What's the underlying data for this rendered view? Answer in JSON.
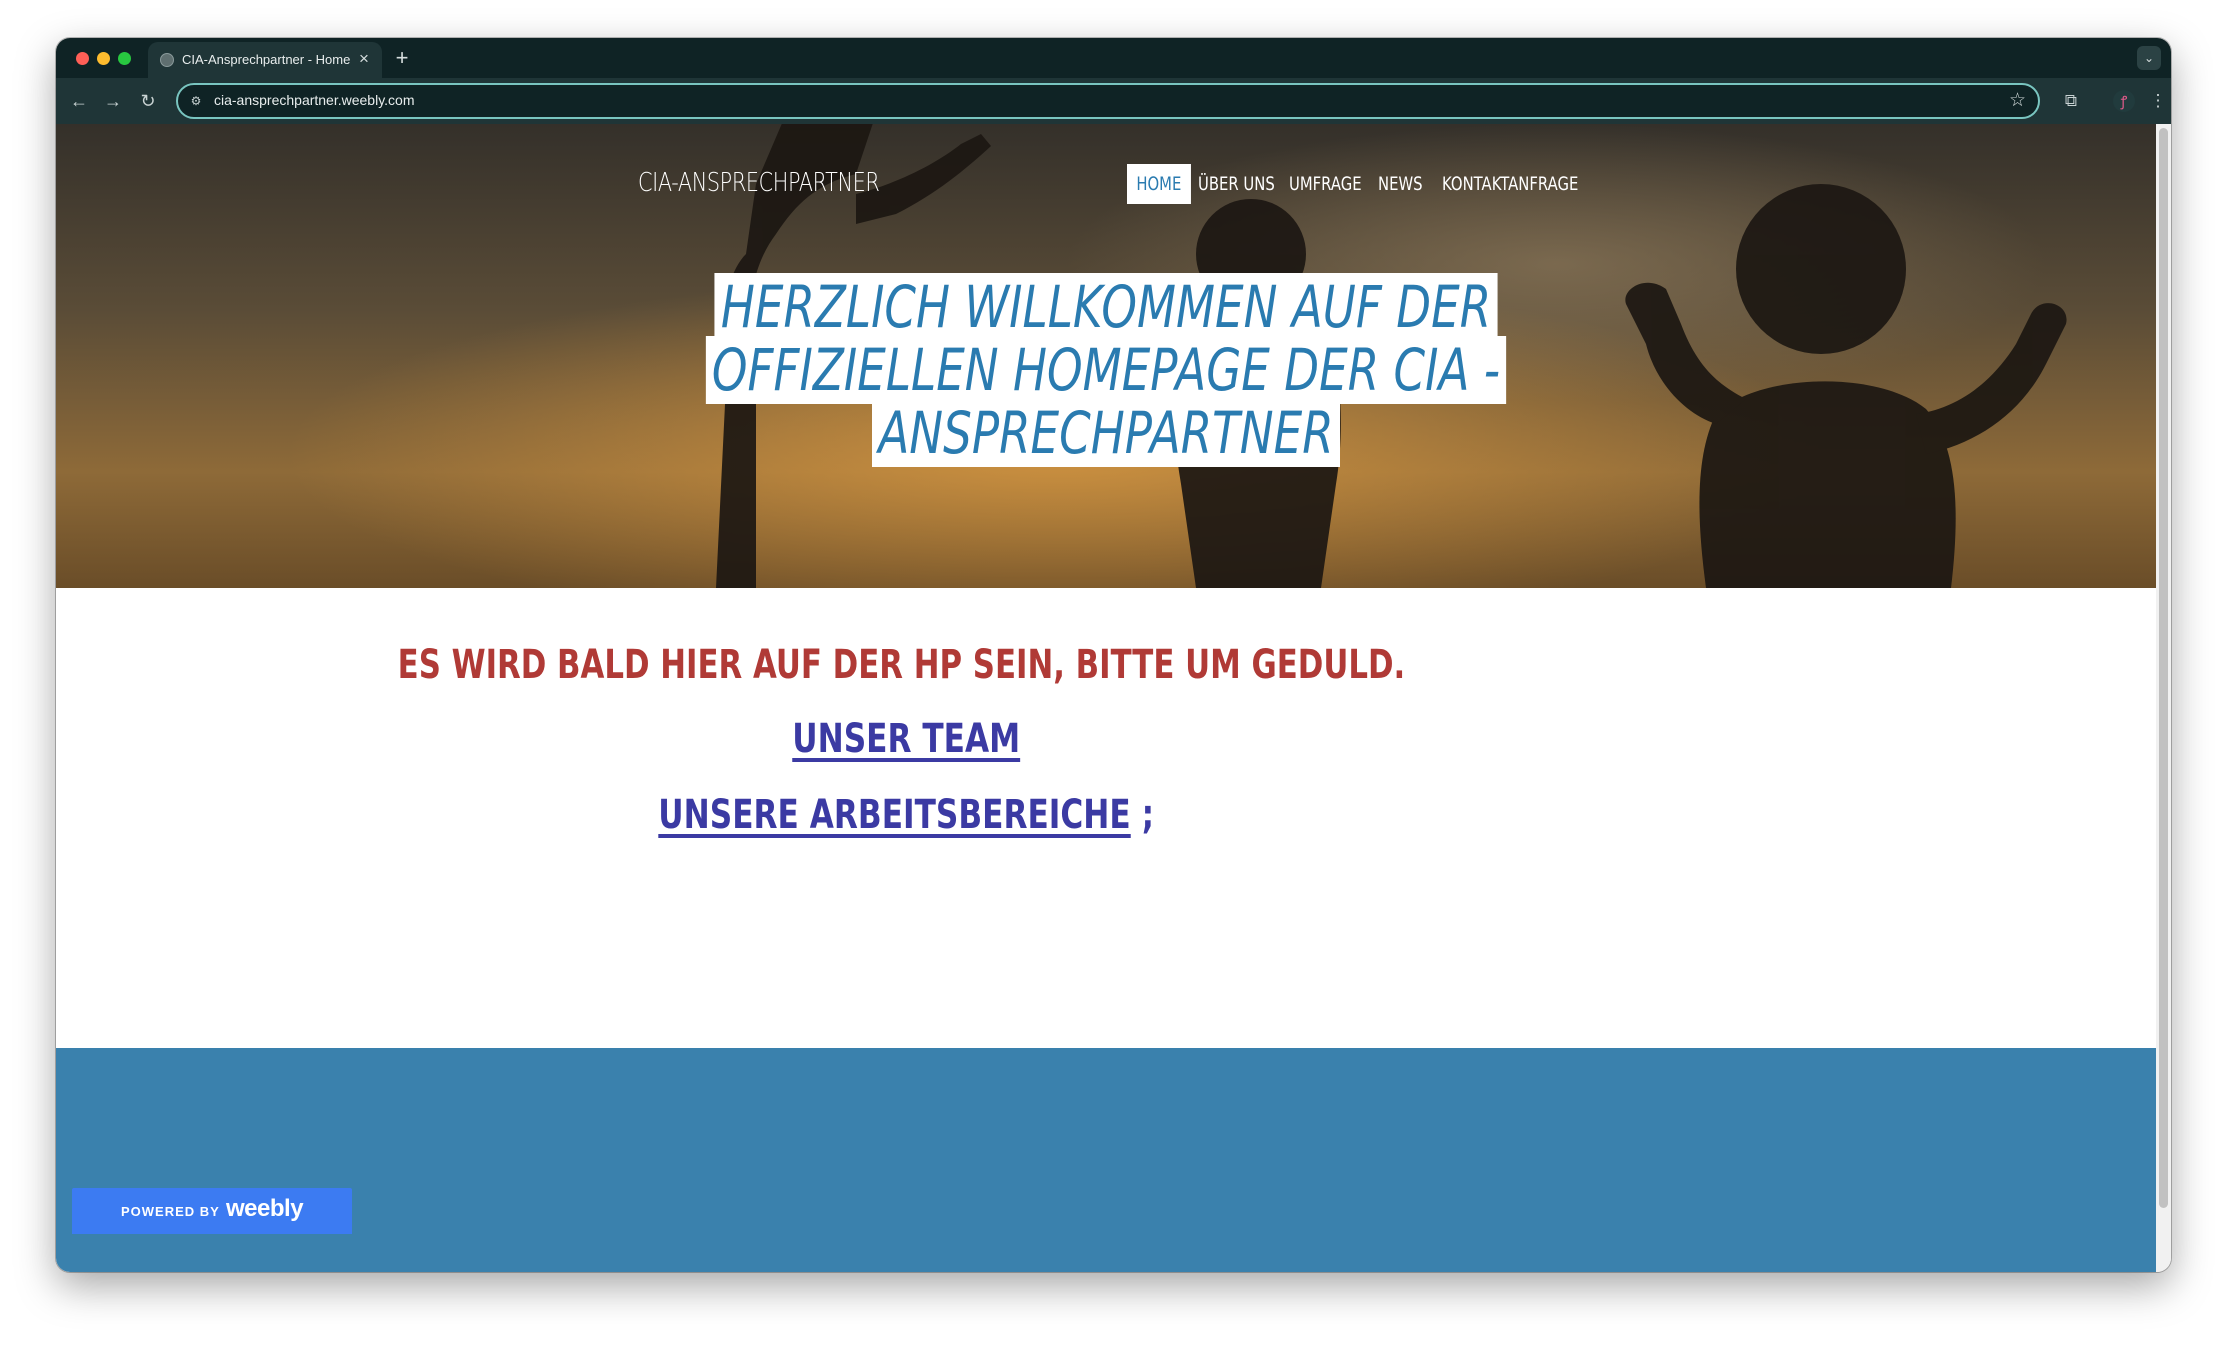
{
  "browser": {
    "tab_title": "CIA-Ansprechpartner - Home",
    "tab_close": "×",
    "new_tab": "+",
    "tab_search": "⌄",
    "back": "←",
    "forward": "→",
    "reload": "↻",
    "site_info": "⚙",
    "url": "cia-ansprechpartner.weebly.com",
    "bookmark": "☆",
    "extensions": "⧉",
    "profile": "ꝭ",
    "menu": "⋮"
  },
  "site": {
    "title": "CIA-ANSPRECHPARTNER",
    "nav": [
      "HOME",
      "ÜBER UNS",
      "UMFRAGE",
      "NEWS",
      "KONTAKTANFRAGE"
    ],
    "active_nav": "HOME",
    "headline_lines": [
      "HERZLICH WILLKOMMEN AUF DER",
      "OFFIZIELLEN HOMEPAGE DER CIA -",
      "ANSPRECHPARTNER"
    ]
  },
  "content": {
    "notice": "ES WIRD BALD HIER AUF DER HP SEIN, BITTE UM GEDULD.",
    "link_team": "UNSER TEAM",
    "link_areas": "UNSERE ARBEITSBEREICHE",
    "link_areas_suffix": ";"
  },
  "badge": {
    "powered_by": "POWERED BY",
    "brand": "weebly"
  },
  "colors": {
    "accent_blue": "#2a7bb0",
    "notice_red": "#b03a36",
    "link_purple": "#3b3aa3",
    "footer_blue": "#3a81ad",
    "badge_blue": "#3c7bf2"
  }
}
